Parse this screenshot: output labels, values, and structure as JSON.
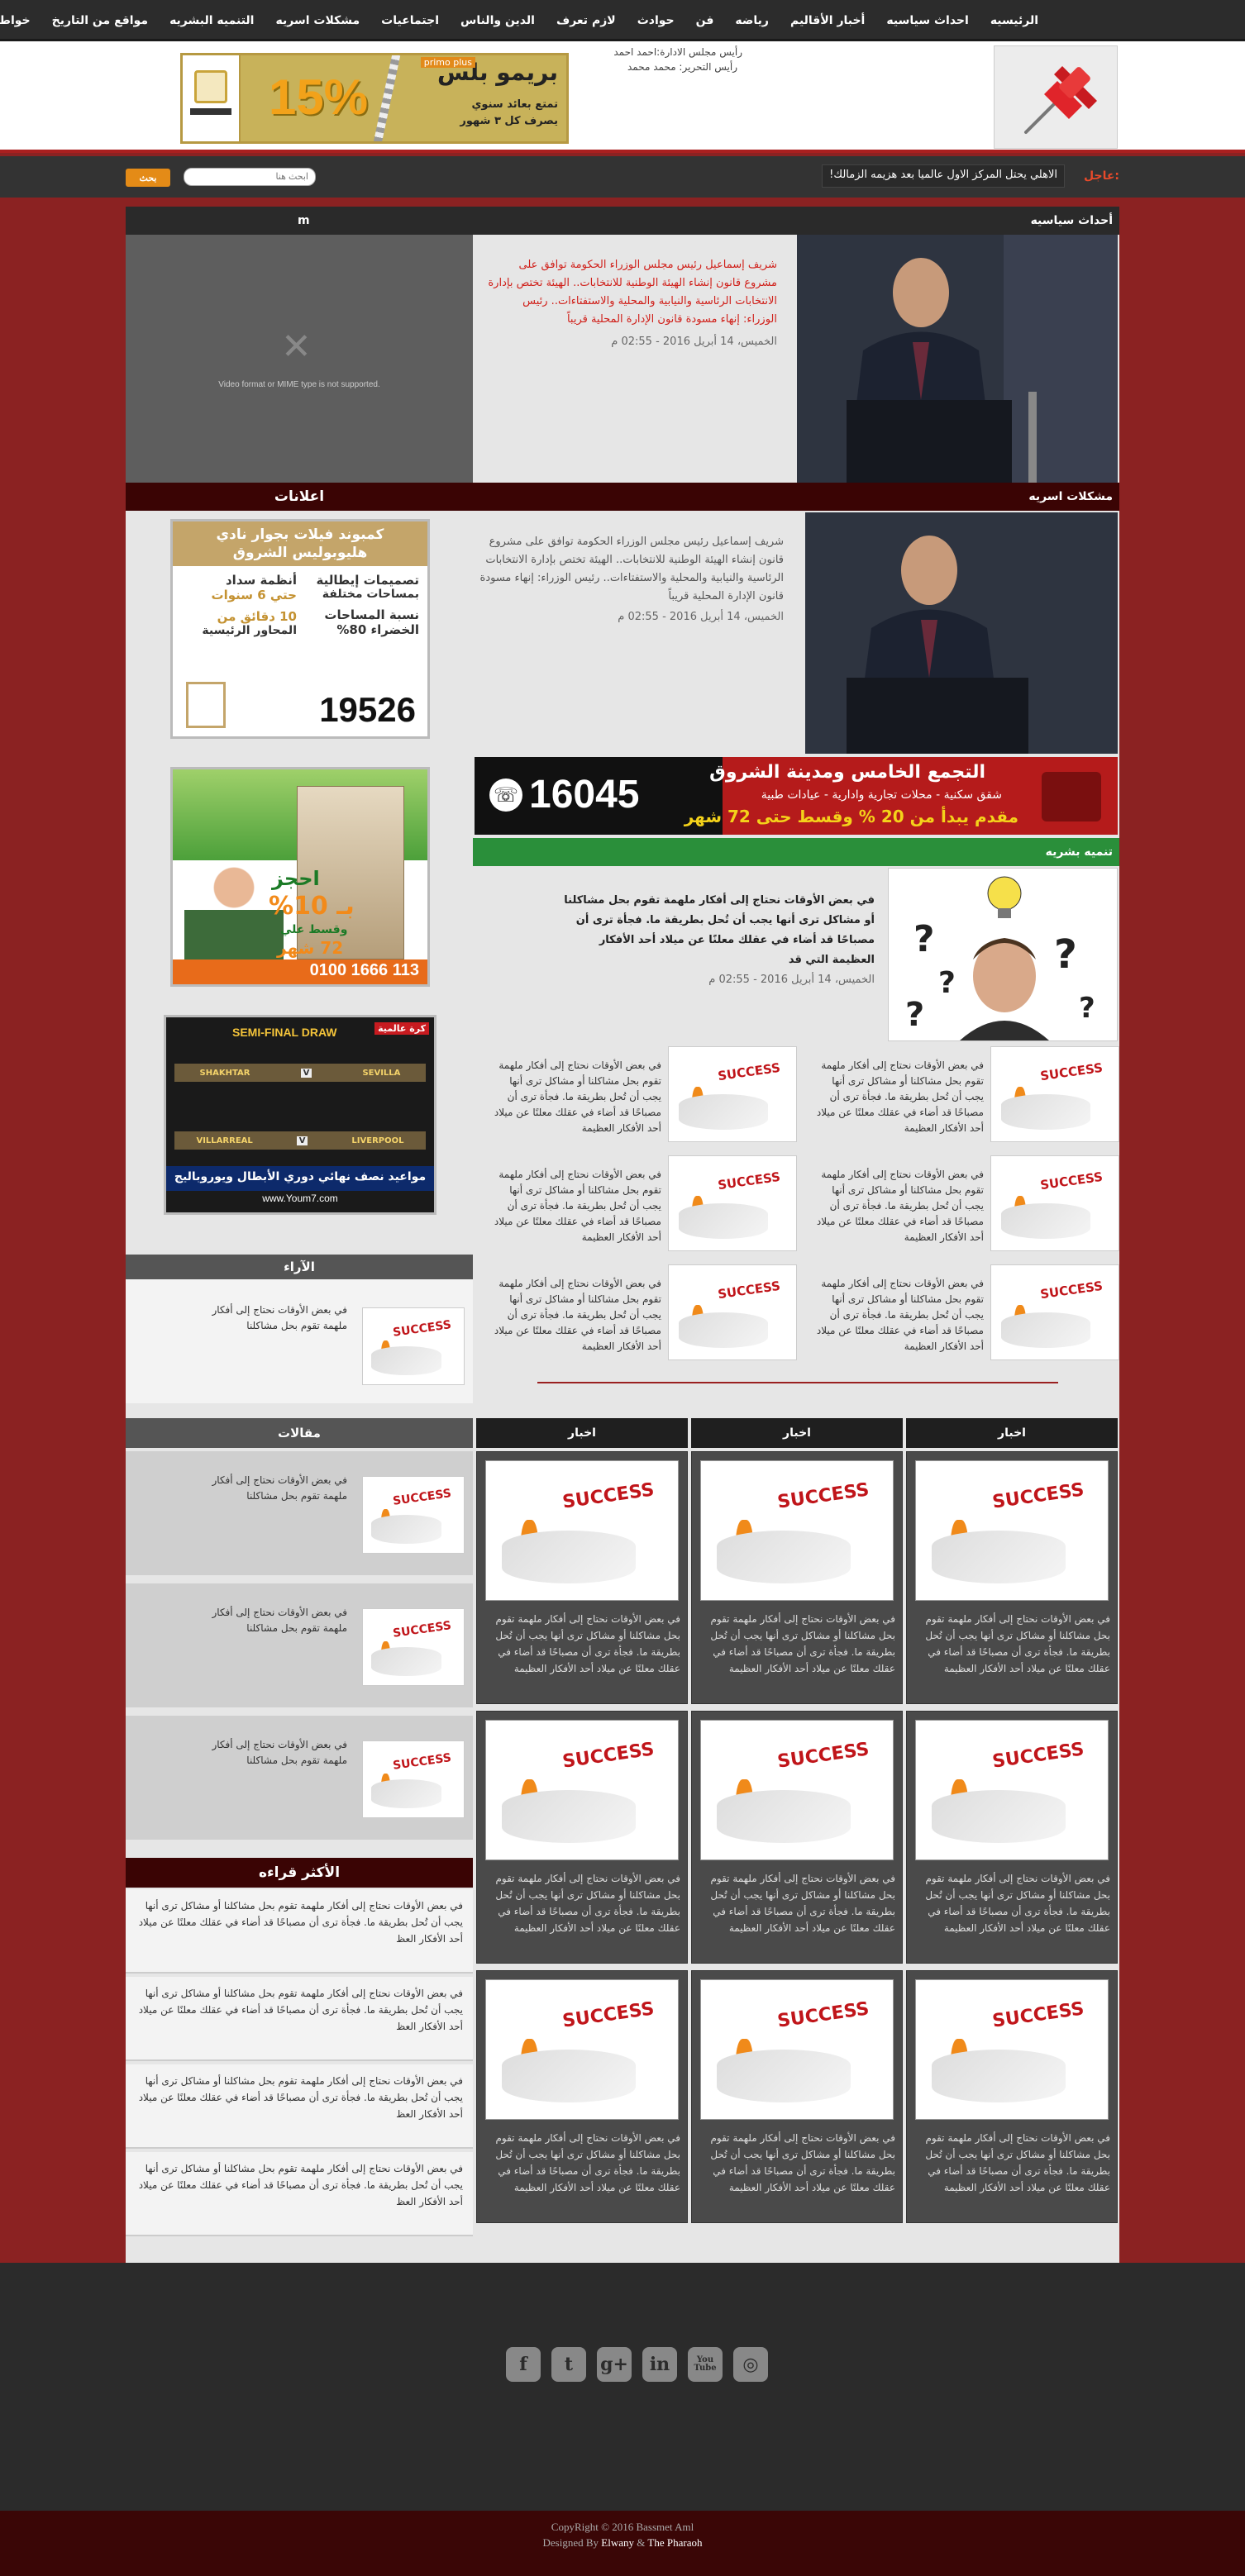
{
  "nav": {
    "items": [
      "الرئيسيه",
      "احداث سياسيه",
      "أخبار الأقاليم",
      "رياضه",
      "فن",
      "حوادث",
      "لازم تعرف",
      "الدين والناس",
      "اجتماعيات",
      "مشكلات اسريه",
      "التنميه البشريه",
      "مواقع من التاريخ",
      "خواطر العامه"
    ]
  },
  "header": {
    "board_line": "رأيس مجلس الادارة:احمد احمد",
    "editor_line": "رأيس التحرير: محمد محمد",
    "ad": {
      "brand": "بريمو بلس",
      "brand_en": "primo plus",
      "percent": "15%",
      "line1": "تمتع بعائد سنوي",
      "line2": "يصرف كل ٣ شهور"
    }
  },
  "ticker": {
    "label": "عاجل:",
    "text": "الاهلي يحتل المركز الاول عالميا بعد هزيمه الزمالك!"
  },
  "search": {
    "placeholder": "ابحث هنا",
    "button": "بحث"
  },
  "political": {
    "title": "أحداث سياسيه",
    "video_label": "m",
    "video_msg": "Video format or MIME type is not supported.",
    "headline": "شريف إسماعيل رئيس مجلس الوزراء الحكومة توافق على مشروع قانون إنشاء الهيئة الوطنية للانتخابات.. الهيئة تختص بإدارة الانتخابات الرئاسية والنيابية والمحلية والاستفتاءات.. رئيس الوزراء: إنهاء مسودة قانون الإدارة المحلية قريباً",
    "date": "الخميس، 14 أبريل 2016 - 02:55 م"
  },
  "ads_title": "اعلانات",
  "family": {
    "title": "مشكلات اسريه",
    "text": "شريف إسماعيل رئيس مجلس الوزراء الحكومة توافق على مشروع قانون إنشاء الهيئة الوطنية للانتخابات.. الهيئة تختص بإدارة الانتخابات الرئاسية والنيابية والمحلية والاستفتاءات.. رئيس الوزراء: إنهاء مسودة قانون الإدارة المحلية قريباً",
    "date": "الخميس، 14 أبريل 2016 - 02:55 م"
  },
  "ad1": {
    "line1": "كمبوند فيلات بجوار نادي",
    "line2": "هليوبوليس الشروق",
    "a": "تصميمات إيطالية",
    "b": "بمساحات مختلفة",
    "c": "أنظمة سداد",
    "d": "حتي 6 سنوات",
    "e": "نسبة المساحات",
    "f": "الخضراء 80%",
    "g": "10 دقائق من",
    "h": "المحاور الرئيسية",
    "phone": "19526"
  },
  "ad2": {
    "a": "احجز",
    "b": "بـ 10%",
    "c": "وقسط علي",
    "d": "72 شهر",
    "phone": "0100 1666 113"
  },
  "ad3": {
    "top": "SEMI-FINAL DRAW",
    "tag": "كرة عالمية",
    "t1": "SHAKHTAR",
    "t2": "SEVILLA",
    "t3": "VILLARREAL",
    "t4": "LIVERPOOL",
    "caption": "مواعيد نصف نهائي دوري الأبطال ويوروباليج",
    "site": "www.Youm7.com"
  },
  "wide_ad": {
    "title": "التجمع الخامس ومدينة الشروق",
    "sub": "شقق سكنية - محلات تجارية وادارية - عيادات طبية",
    "offer": "مقدم يبدأ من 20 % وقسط حتى 72 شهر",
    "phone": "16045"
  },
  "development": {
    "title": "تنميه بشريه",
    "lead": "في بعض الأوقات نحتاج إلى أفكار ملهمة تقوم بحل مشاكلنا أو مشاكل ترى أنها يجب أن تُحل بطريقة ما. فجأة ترى أن مصباحًا قد أضاء في عقلك معلنًا عن ميلاد أحد الأفكار العظيمة التي قد",
    "date": "الخميس، 14 أبريل 2016 - 02:55 م",
    "item_text": "في بعض الأوقات نحتاج إلى أفكار ملهمة تقوم بحل مشاكلنا أو مشاكل ترى أنها يجب أن تُحل بطريقة ما. فجأة ترى أن مصباحًا قد أضاء في عقلك معلنًا عن ميلاد أحد الأفكار العظيمة"
  },
  "success_word": "SUCCESS",
  "opinions": {
    "title": "الآراء",
    "text": "في بعض الأوقات نحتاج إلى أفكار ملهمة تقوم بحل مشاكلنا"
  },
  "articles": {
    "title": "مقالات",
    "text": "في بعض الأوقات نحتاج إلى أفكار ملهمة تقوم بحل مشاكلنا"
  },
  "news": {
    "title": "اخبار",
    "text": "في بعض الأوقات نحتاج إلى أفكار ملهمة تقوم بحل مشاكلنا أو مشاكل ترى أنها يجب أن تُحل بطريقة ما. فجأة ترى أن مصباحًا قد أضاء في عقلك معلنًا عن ميلاد أحد الأفكار العظيمة"
  },
  "most_read": {
    "title": "الأكثر قراءه",
    "text": "في بعض الأوقات نحتاج إلى أفكار ملهمة تقوم بحل مشاكلنا أو مشاكل ترى أنها يجب أن تُحل بطريقة ما. فجأة ترى أن مصباحًا قد أضاء في عقلك معلنًا عن ميلاد أحد الأفكار العظ"
  },
  "social": [
    "facebook-icon",
    "twitter-icon",
    "google-plus-icon",
    "linkedin-icon",
    "youtube-icon",
    "instagram-icon"
  ],
  "social_glyphs": [
    "f",
    "t",
    "g+",
    "in",
    "You Tube",
    "◎"
  ],
  "footer": {
    "copyright": "CopyRight © 2016 Bassmet Aml",
    "designed_prefix": "Designed By",
    "designer1": "Elwany",
    "amp": "&",
    "designer2": "The Pharaoh"
  },
  "colors": {
    "page_bg": "#8b2222",
    "nav_bg": "#2c2c2c",
    "accent_red": "#d0201a",
    "search_btn": "#e48b17",
    "maroon": "#3a0404",
    "green": "#2a8f3a"
  }
}
